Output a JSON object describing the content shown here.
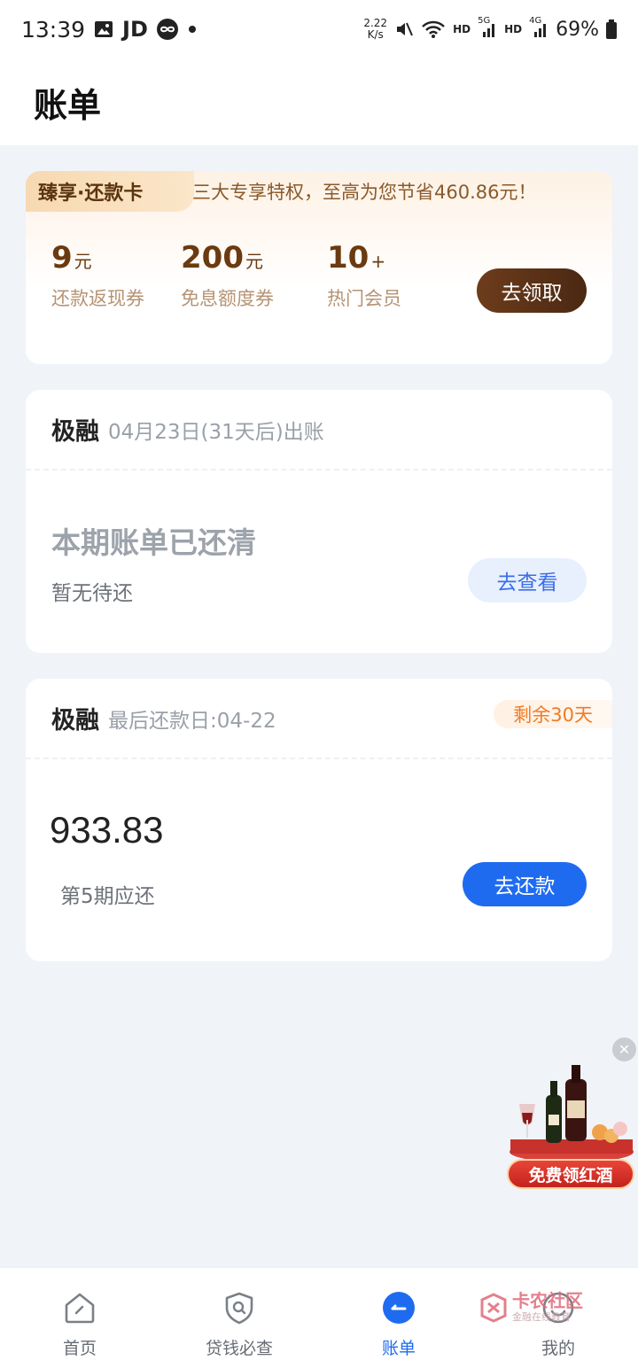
{
  "status_bar": {
    "time": "13:39",
    "carrier_app": "JD",
    "net_speed_value": "2.22",
    "net_speed_unit": "K/s",
    "hd1": "HD",
    "sig1": "5G",
    "hd2": "HD",
    "sig2": "4G",
    "battery": "69%"
  },
  "header": {
    "title": "账单"
  },
  "promo": {
    "tag": "臻享·还款卡",
    "description": "三大专享特权，至高为您节省460.86元！",
    "perks": [
      {
        "value": "9",
        "unit": "元",
        "label": "还款返现券"
      },
      {
        "value": "200",
        "unit": "元",
        "label": "免息额度券"
      },
      {
        "value": "10",
        "unit": "+",
        "label": "热门会员"
      }
    ],
    "button": "去领取"
  },
  "bill_upcoming": {
    "name": "极融",
    "subtitle": "04月23日(31天后)出账",
    "status_title": "本期账单已还清",
    "status_sub": "暂无待还",
    "button": "去查看"
  },
  "bill_due": {
    "name": "极融",
    "subtitle": "最后还款日:04-22",
    "badge": "剩余30天",
    "amount": "933.83",
    "period_label": "第5期应还",
    "button": "去还款"
  },
  "float_promo": {
    "label": "免费领红酒"
  },
  "watermark": {
    "title": "卡农社区",
    "sub": "金融在线教育"
  },
  "bottom_nav": {
    "items": [
      {
        "label": "首页",
        "icon": "home-icon"
      },
      {
        "label": "贷钱必查",
        "icon": "shield-search-icon"
      },
      {
        "label": "账单",
        "icon": "bill-icon"
      },
      {
        "label": "我的",
        "icon": "profile-icon"
      }
    ],
    "active_index": 2
  },
  "colors": {
    "accent": "#1f6bf0",
    "promo_brown": "#6b3a10",
    "badge_orange": "#f07b25"
  }
}
